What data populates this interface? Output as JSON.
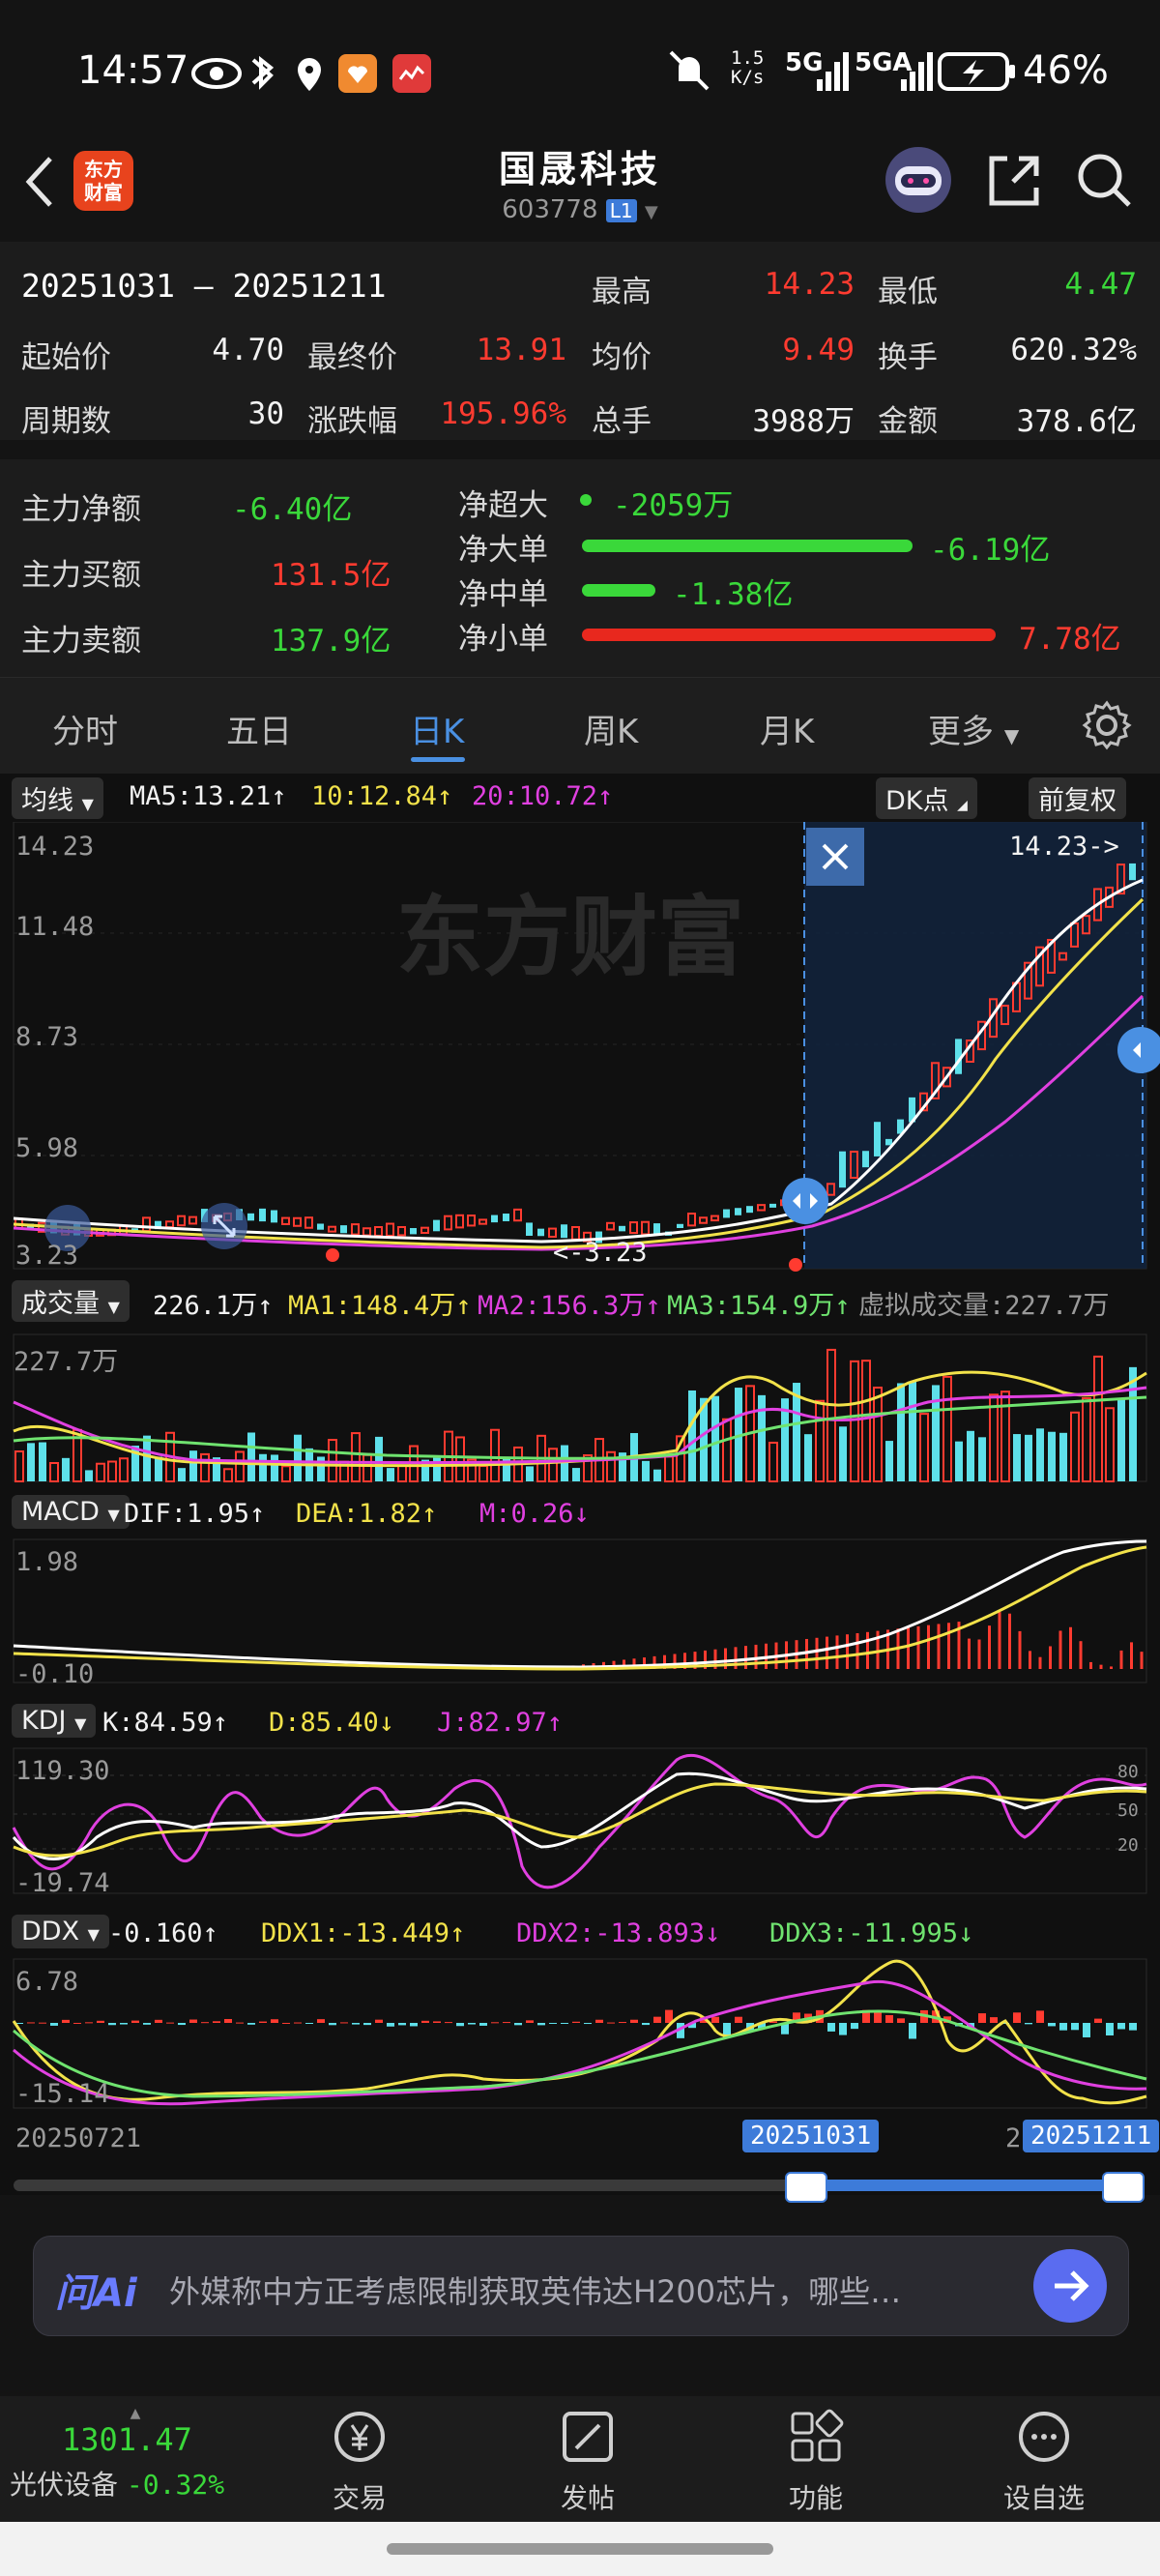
{
  "status_bar": {
    "time": "14:57",
    "net_speed_top": "1.5",
    "net_speed_bottom": "K/s",
    "signal_a": "5G",
    "signal_b": "5GA",
    "battery": "46%"
  },
  "header": {
    "title": "国晟科技",
    "code": "603778",
    "level_badge": "L1",
    "logo_line1": "东方",
    "logo_line2": "财富"
  },
  "summary": {
    "range": "20251031 — 20251211",
    "rows": [
      [
        {
          "label": "最高",
          "value": "14.23"
        },
        {
          "label": "最低",
          "value": "4.47"
        }
      ],
      [
        {
          "label": "起始价",
          "value": "4.70"
        },
        {
          "label": "最终价",
          "value": "13.91"
        },
        {
          "label": "均价",
          "value": "9.49"
        },
        {
          "label": "换手",
          "value": "620.32%"
        }
      ],
      [
        {
          "label": "周期数",
          "value": "30"
        },
        {
          "label": "涨跌幅",
          "value": "195.96%"
        },
        {
          "label": "总手",
          "value": "3988万"
        },
        {
          "label": "金额",
          "value": "378.6亿"
        }
      ]
    ]
  },
  "flow": {
    "main": [
      {
        "label": "主力净额",
        "value": "-6.40亿"
      },
      {
        "label": "主力买额",
        "value": "131.5亿"
      },
      {
        "label": "主力卖额",
        "value": "137.9亿"
      }
    ],
    "orders": [
      {
        "label": "净超大",
        "value": "-2059万",
        "fill": 0.0
      },
      {
        "label": "净大单",
        "value": "-6.19亿",
        "fill": 0.8
      },
      {
        "label": "净中单",
        "value": "-1.38亿",
        "fill": 0.18
      },
      {
        "label": "净小单",
        "value": "7.78亿",
        "fill": 1.0
      }
    ]
  },
  "tabs": {
    "items": [
      "分时",
      "五日",
      "日K",
      "周K",
      "月K",
      "更多"
    ],
    "active": "日K"
  },
  "kline": {
    "selector": "均线",
    "ma5": "MA5:13.21",
    "ma10": "10:12.84",
    "ma20": "20:10.72",
    "dk_button": "DK点",
    "fq_button": "前复权",
    "y_labels": [
      "14.23",
      "11.48",
      "8.73",
      "5.98",
      "3.23"
    ],
    "high_marker": "14.23->",
    "low_marker": "<-3.23",
    "watermark": "东方财富"
  },
  "volume": {
    "selector": "成交量",
    "vol": "226.1万",
    "ma1": "MA1:148.4万",
    "ma2": "MA2:156.3万",
    "ma3": "MA3:154.9万",
    "virtual": "虚拟成交量:227.7万",
    "y_top": "227.7万"
  },
  "macd": {
    "selector": "MACD",
    "dif": "DIF:1.95",
    "dea": "DEA:1.82",
    "m": "M:0.26",
    "y_top": "1.98",
    "y_bottom": "-0.10"
  },
  "kdj": {
    "selector": "KDJ",
    "k": "K:84.59",
    "d": "D:85.40",
    "j": "J:82.97",
    "y_top": "119.30",
    "y_bottom": "-19.74",
    "ref80": "80",
    "ref50": "50",
    "ref20": "20"
  },
  "ddx": {
    "selector": "DDX",
    "value": "-0.160",
    "ddx1": "DDX1:-13.449",
    "ddx2": "DDX2:-13.893",
    "ddx3": "DDX3:-11.995",
    "y_top": "6.78",
    "y_bottom": "-15.14"
  },
  "timeline": {
    "start": "20250721",
    "sel_start": "20251031",
    "sel_end": "20251211",
    "prefix": "2"
  },
  "ai": {
    "brand": "问Ai",
    "text": "外媒称中方正考虑限制获取英伟达H200芯片，哪些…"
  },
  "bottom_nav": {
    "index_value": "1301.47",
    "index_name": "光伏设备",
    "index_change": "-0.32%",
    "items": [
      "交易",
      "发帖",
      "功能",
      "设自选"
    ]
  },
  "colors": {
    "up": "#ff3b30",
    "down": "#3ad83a",
    "accent": "#4a90e2",
    "ma5": "#ffffff",
    "ma10": "#f2e24a",
    "ma20": "#e040e0"
  }
}
